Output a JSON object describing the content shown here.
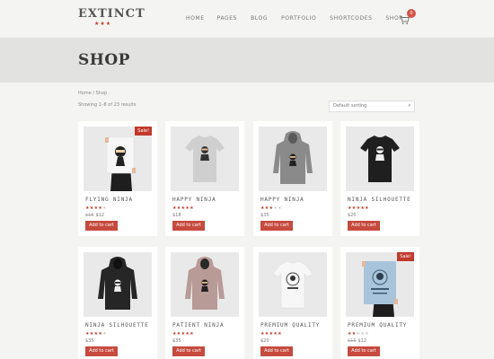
{
  "header": {
    "logo_text": "EXTINCT",
    "logo_stars": "★★★",
    "nav": [
      "HOME",
      "PAGES",
      "BLOG",
      "PORTFOLIO",
      "SHORTCODES",
      "SHOP"
    ],
    "cart_count": "0",
    "accent_color": "#c0392b"
  },
  "page": {
    "title": "SHOP",
    "breadcrumb": "Home / Shop",
    "result_count": "Showing 1–8 of 23 results",
    "sort_label": "Default sorting",
    "sort_arrow": "▾"
  },
  "products": [
    {
      "name": "FLYING NINJA",
      "rating": 4,
      "price": "$12",
      "old_price": "$15",
      "sale": "Sale!",
      "button": "Add to cart",
      "image": "poster-held"
    },
    {
      "name": "HAPPY NINJA",
      "rating": 5,
      "price": "$18",
      "old_price": "",
      "sale": "",
      "button": "Add to cart",
      "image": "tshirt-grey"
    },
    {
      "name": "HAPPY NINJA",
      "rating": 3,
      "price": "$35",
      "old_price": "",
      "sale": "",
      "button": "Add to cart",
      "image": "hoodie-grey"
    },
    {
      "name": "NINJA SILHOUETTE",
      "rating": 5,
      "price": "$20",
      "old_price": "",
      "sale": "",
      "button": "Add to cart",
      "image": "tshirt-black"
    },
    {
      "name": "NINJA SILHOUETTE",
      "rating": 4,
      "price": "$35",
      "old_price": "",
      "sale": "",
      "button": "Add to cart",
      "image": "hoodie-black"
    },
    {
      "name": "PATIENT NINJA",
      "rating": 5,
      "price": "$35",
      "old_price": "",
      "sale": "",
      "button": "Add to cart",
      "image": "hoodie-pink"
    },
    {
      "name": "PREMIUM QUALITY",
      "rating": 4.5,
      "price": "$20",
      "old_price": "",
      "sale": "",
      "button": "Add to cart",
      "image": "tshirt-white"
    },
    {
      "name": "PREMIUM QUALITY",
      "rating": 2,
      "price": "$12",
      "old_price": "$15",
      "sale": "Sale!",
      "button": "Add to cart",
      "image": "poster-blue"
    }
  ]
}
